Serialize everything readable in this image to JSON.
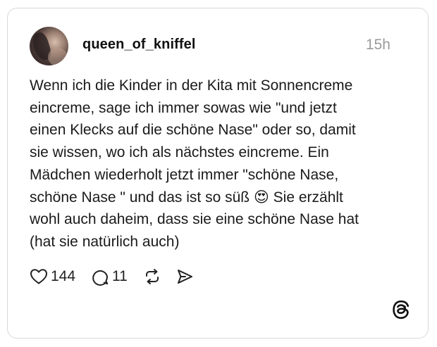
{
  "post": {
    "username": "queen_of_kniffel",
    "timestamp": "15h",
    "text": "Wenn ich die Kinder in der Kita mit Sonnencreme\neincreme, sage ich immer sowas wie \"und jetzt\neinen Klecks auf die schöne Nase\" oder so, damit\nsie wissen, wo ich als nächstes eincreme. Ein\nMädchen wiederholt jetzt immer \"schöne Nase,\nschöne Nase \" und das ist so süß 😍 Sie erzählt\nwohl auch daheim, dass sie eine schöne Nase hat\n(hat sie natürlich auch)",
    "likes": "144",
    "replies": "11"
  },
  "icons": {
    "like": "heart-icon",
    "reply": "comment-bubble-icon",
    "repost": "repost-icon",
    "share": "send-icon",
    "brand": "threads-logo-icon"
  },
  "colors": {
    "border": "#d9d9d9",
    "timestamp": "#9a9a9a",
    "text": "#1a1a1a"
  }
}
